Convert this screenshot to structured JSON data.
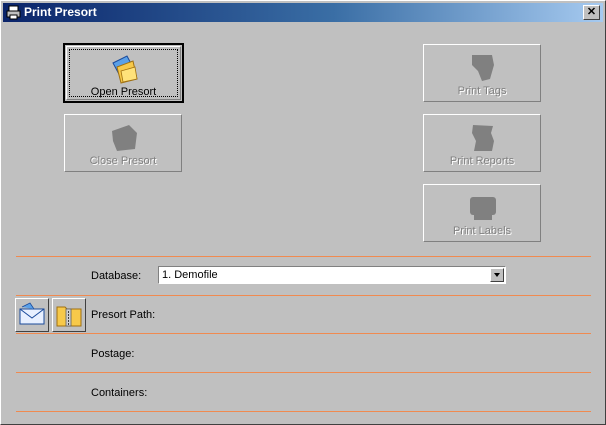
{
  "window": {
    "title": "Print Presort",
    "close_label": "✕"
  },
  "buttons": {
    "open_presort": "Open Presort",
    "close_presort": "Close Presort",
    "print_tags": "Print Tags",
    "print_reports": "Print Reports",
    "print_labels": "Print Labels"
  },
  "form": {
    "database_label": "Database:",
    "database_value": "1. Demofile",
    "presort_path_label": "Presort Path:",
    "presort_path_value": "",
    "postage_label": "Postage:",
    "postage_value": "",
    "containers_label": "Containers:",
    "containers_value": ""
  },
  "colors": {
    "separator": "#f08a50",
    "titlebar_start": "#0a246a",
    "titlebar_end": "#a6caf0"
  }
}
